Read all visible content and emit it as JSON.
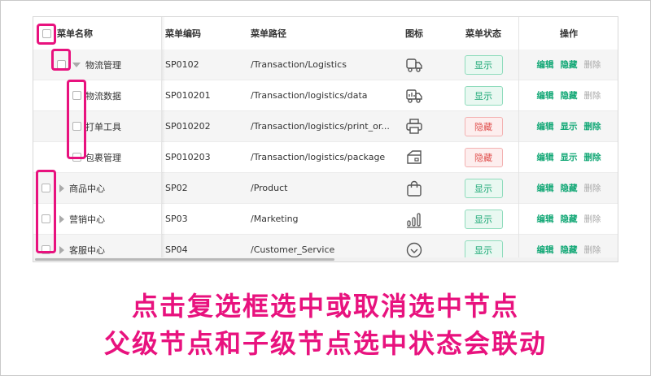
{
  "table": {
    "columns": {
      "name": "菜单名称",
      "code": "菜单编码",
      "path": "菜单路径",
      "icon": "图标",
      "status": "菜单状态",
      "ops": "操作"
    },
    "rows": [
      {
        "name": "物流管理",
        "code": "SP0102",
        "path": "/Transaction/Logistics",
        "icon": "truck-icon",
        "status": "显示",
        "ops": [
          "编辑",
          "隐藏",
          "删除"
        ]
      },
      {
        "name": "物流数据",
        "code": "SP010201",
        "path": "/Transaction/logistics/data",
        "icon": "delivery-stats-icon",
        "status": "显示",
        "ops": [
          "编辑",
          "隐藏",
          "删除"
        ]
      },
      {
        "name": "打单工具",
        "code": "SP010202",
        "path": "/Transaction/logistics/print_or...",
        "icon": "printer-icon",
        "status": "隐藏",
        "ops": [
          "编辑",
          "显示",
          "删除"
        ]
      },
      {
        "name": "包裹管理",
        "code": "SP010203",
        "path": "/Transaction/logistics/package",
        "icon": "package-icon",
        "status": "隐藏",
        "ops": [
          "编辑",
          "显示",
          "删除"
        ]
      },
      {
        "name": "商品中心",
        "code": "SP02",
        "path": "/Product",
        "icon": "shopping-bag-icon",
        "status": "显示",
        "ops": [
          "编辑",
          "隐藏",
          "删除"
        ]
      },
      {
        "name": "营销中心",
        "code": "SP03",
        "path": "/Marketing",
        "icon": "bar-chart-icon",
        "status": "显示",
        "ops": [
          "编辑",
          "隐藏",
          "删除"
        ]
      },
      {
        "name": "客服中心",
        "code": "SP04",
        "path": "/Customer_Service",
        "icon": "customer-service-icon",
        "status": "显示",
        "ops": [
          "编辑",
          "隐藏",
          "删除"
        ]
      }
    ]
  },
  "caption": {
    "line1": "点击复选框选中或取消选中节点",
    "line2": "父级节点和子级节点选中状态会联动"
  },
  "colors": {
    "highlight": "#e8127e",
    "action": "#13a876",
    "show_tag": "#17a673",
    "hide_tag": "#e0504e",
    "disabled": "#a8a8a8"
  }
}
